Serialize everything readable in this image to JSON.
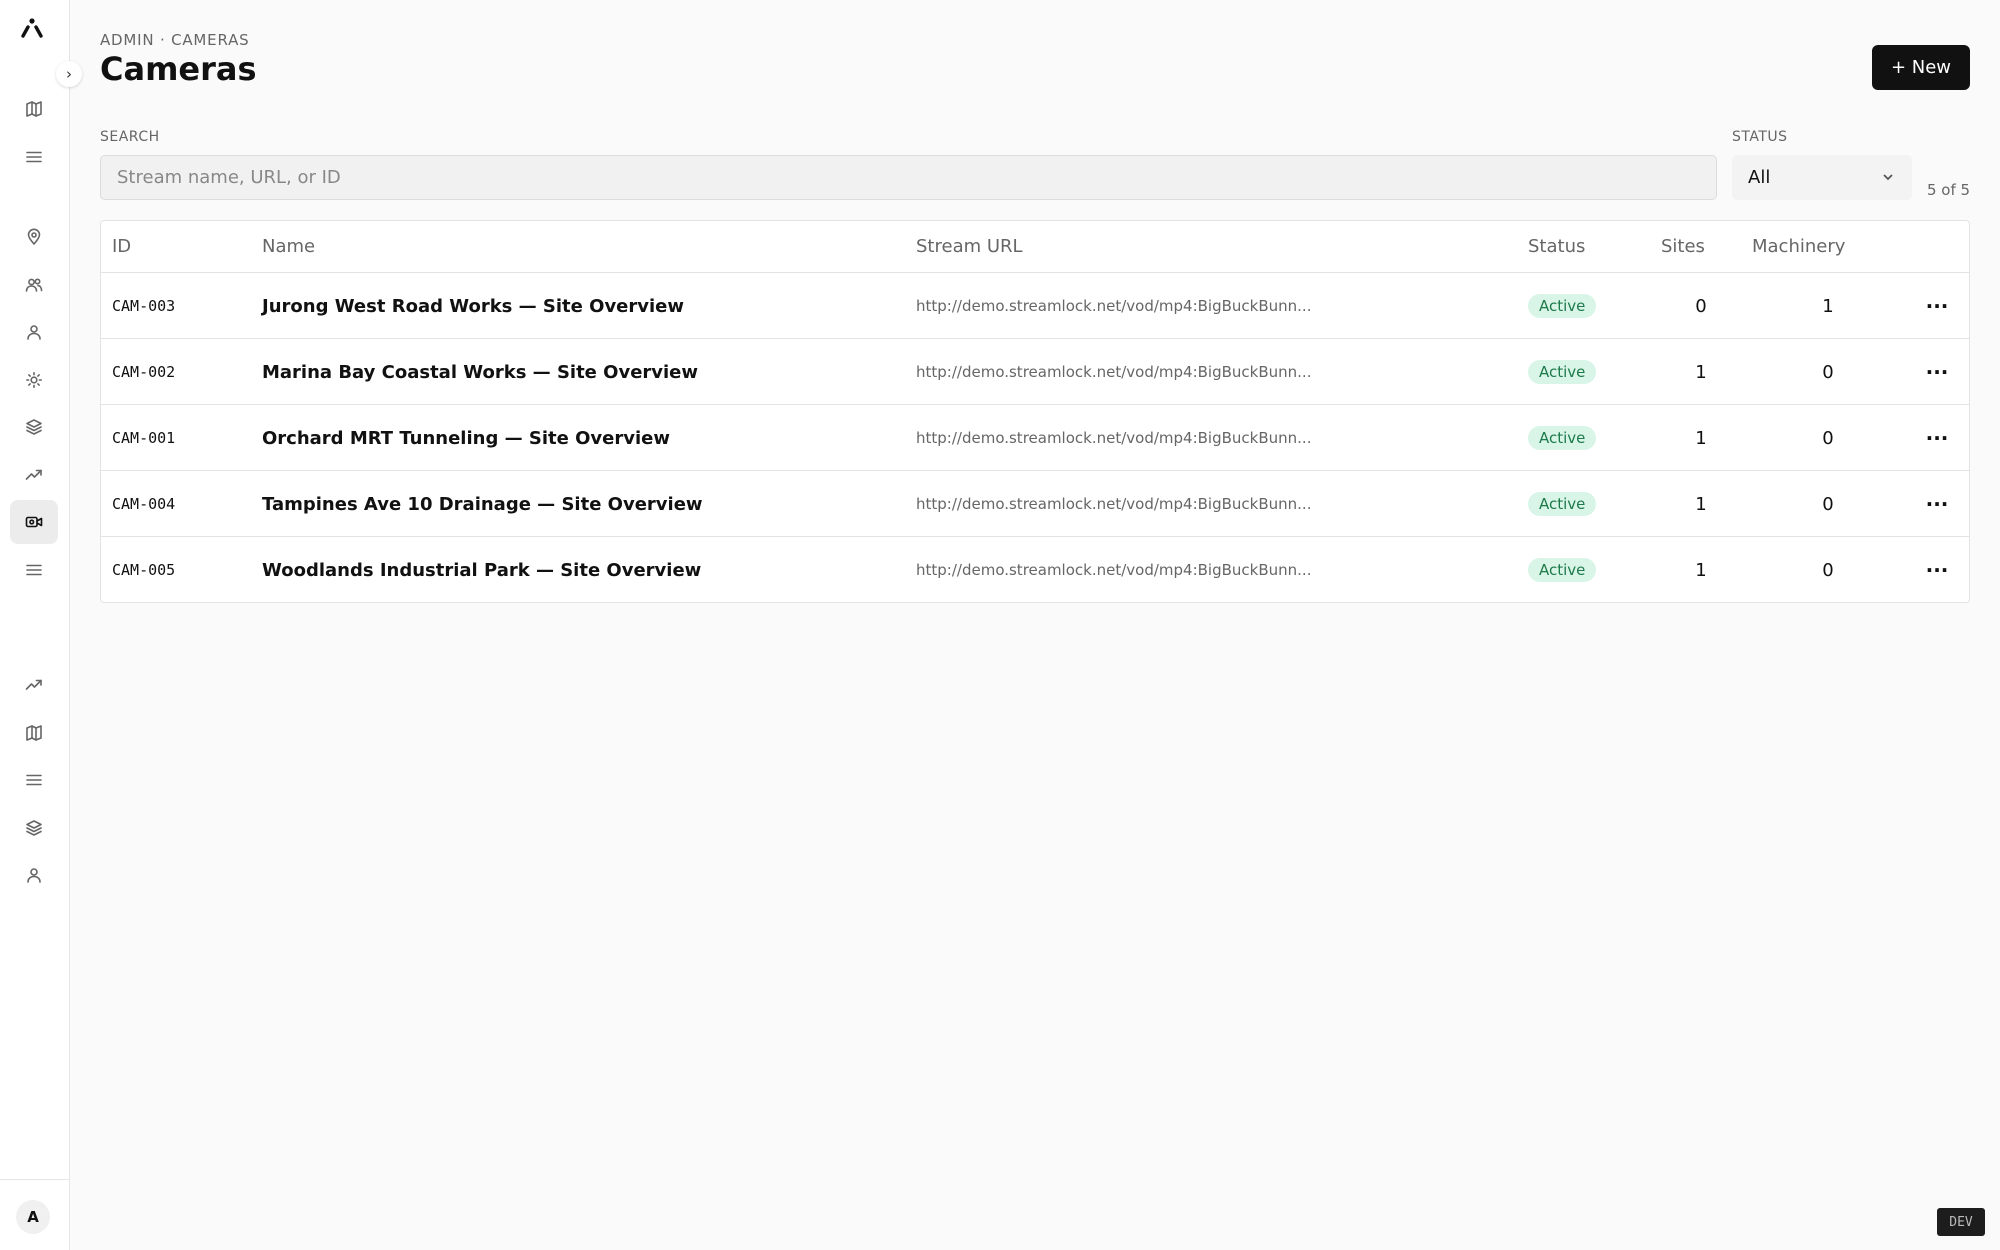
{
  "sidebar": {
    "collapse_icon": "chevron-right-icon",
    "nav_top": [
      {
        "icon": "map-icon"
      },
      {
        "icon": "menu-icon"
      }
    ],
    "nav_main": [
      {
        "icon": "map-pin-icon"
      },
      {
        "icon": "users-icon"
      },
      {
        "icon": "user-icon"
      },
      {
        "icon": "sun-icon"
      },
      {
        "icon": "layers-icon"
      },
      {
        "icon": "trending-up-icon"
      },
      {
        "icon": "camera-icon",
        "active": true
      },
      {
        "icon": "menu-icon"
      }
    ],
    "nav_bottom": [
      {
        "icon": "trending-up-icon"
      },
      {
        "icon": "map-icon"
      },
      {
        "icon": "menu-icon"
      },
      {
        "icon": "layers-icon"
      },
      {
        "icon": "user-icon"
      }
    ],
    "avatar_initial": "A"
  },
  "header": {
    "breadcrumb": "ADMIN · CAMERAS",
    "title": "Cameras",
    "new_button": "+ New"
  },
  "filters": {
    "search_label": "SEARCH",
    "search_placeholder": "Stream name, URL, or ID",
    "search_value": "",
    "status_label": "STATUS",
    "status_value": "All",
    "count": "5 of 5"
  },
  "table": {
    "columns": [
      "ID",
      "Name",
      "Stream URL",
      "Status",
      "Sites",
      "Machinery"
    ],
    "rows": [
      {
        "id": "CAM-003",
        "name": "Jurong West Road Works — Site Overview",
        "url": "http://demo.streamlock.net/vod/mp4:BigBuckBunn...",
        "status": "Active",
        "sites": "0",
        "machinery": "1"
      },
      {
        "id": "CAM-002",
        "name": "Marina Bay Coastal Works — Site Overview",
        "url": "http://demo.streamlock.net/vod/mp4:BigBuckBunn...",
        "status": "Active",
        "sites": "1",
        "machinery": "0"
      },
      {
        "id": "CAM-001",
        "name": "Orchard MRT Tunneling — Site Overview",
        "url": "http://demo.streamlock.net/vod/mp4:BigBuckBunn...",
        "status": "Active",
        "sites": "1",
        "machinery": "0"
      },
      {
        "id": "CAM-004",
        "name": "Tampines Ave 10 Drainage — Site Overview",
        "url": "http://demo.streamlock.net/vod/mp4:BigBuckBunn...",
        "status": "Active",
        "sites": "1",
        "machinery": "0"
      },
      {
        "id": "CAM-005",
        "name": "Woodlands Industrial Park — Site Overview",
        "url": "http://demo.streamlock.net/vod/mp4:BigBuckBunn...",
        "status": "Active",
        "sites": "1",
        "machinery": "0"
      }
    ],
    "row_menu_label": "···"
  },
  "env_badge": "DEV",
  "colors": {
    "primary": "#111111",
    "active_badge_bg": "#d9f5e7",
    "active_badge_text": "#1d7a4a"
  }
}
